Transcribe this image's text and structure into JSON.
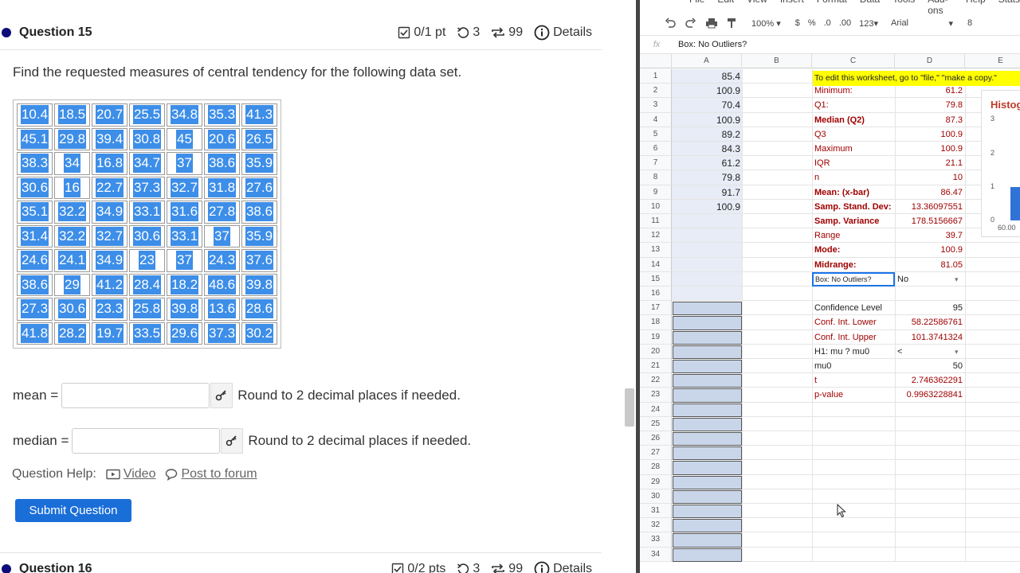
{
  "q15": {
    "title": "Question 15",
    "points": "0/1 pt",
    "retries": "3",
    "attempts": "99",
    "details": "Details",
    "prompt": "Find the requested measures of central tendency for the following data set.",
    "grid": [
      [
        "10.4",
        "18.5",
        "20.7",
        "25.5",
        "34.8",
        "35.3",
        "41.3"
      ],
      [
        "45.1",
        "29.8",
        "39.4",
        "30.8",
        "45",
        "20.6",
        "26.5"
      ],
      [
        "38.3",
        "34",
        "16.8",
        "34.7",
        "37",
        "38.6",
        "35.9"
      ],
      [
        "30.6",
        "16",
        "22.7",
        "37.3",
        "32.7",
        "31.8",
        "27.6"
      ],
      [
        "35.1",
        "32.2",
        "34.9",
        "33.1",
        "31.6",
        "27.8",
        "38.6"
      ],
      [
        "31.4",
        "32.2",
        "32.7",
        "30.6",
        "33.1",
        "37",
        "35.9"
      ],
      [
        "24.6",
        "24.1",
        "34.9",
        "23",
        "37",
        "24.3",
        "37.6"
      ],
      [
        "38.6",
        "29",
        "41.2",
        "28.4",
        "18.2",
        "48.6",
        "39.8"
      ],
      [
        "27.3",
        "30.6",
        "23.3",
        "25.8",
        "39.8",
        "13.6",
        "28.6"
      ],
      [
        "41.8",
        "28.2",
        "19.7",
        "33.5",
        "29.6",
        "37.3",
        "30.2"
      ]
    ],
    "mean_label": "mean =",
    "median_label": "median =",
    "round_hint": "Round to 2 decimal places if needed.",
    "help_label": "Question Help:",
    "video_label": "Video",
    "forum_label": "Post to forum",
    "submit_label": "Submit Question"
  },
  "q16": {
    "title": "Question 16",
    "points": "0/2 pts",
    "retries": "3",
    "attempts": "99",
    "details": "Details"
  },
  "sheet": {
    "menu": [
      "File",
      "Edit",
      "View",
      "Insert",
      "Format",
      "Data",
      "Tools",
      "Add-ons",
      "Help",
      "Stats"
    ],
    "zoom": "100%",
    "currency": "$",
    "percent": "%",
    "dec_less": ".0",
    "dec_more": ".00",
    "numfmt": "123",
    "font": "Arial",
    "font_size": "8",
    "fx_label": "fx",
    "formula": "Box: No Outliers?",
    "columns": [
      "A",
      "B",
      "C",
      "D",
      "E"
    ],
    "colA": [
      "85.4",
      "100.9",
      "70.4",
      "100.9",
      "89.2",
      "84.3",
      "61.2",
      "79.8",
      "91.7",
      "100.9"
    ],
    "banner": "To edit this worksheet, go to \"file,\" \"make a copy.\"",
    "stats": [
      {
        "label": "Minimum:",
        "value": "61.2",
        "bold": false
      },
      {
        "label": "Q1:",
        "value": "79.8",
        "bold": false
      },
      {
        "label": "Median (Q2)",
        "value": "87.3",
        "bold": true
      },
      {
        "label": "Q3",
        "value": "100.9",
        "bold": false
      },
      {
        "label": "Maximum",
        "value": "100.9",
        "bold": false
      },
      {
        "label": "IQR",
        "value": "21.1",
        "bold": false
      },
      {
        "label": "n",
        "value": "10",
        "bold": false
      },
      {
        "label": "Mean: (x-bar)",
        "value": "86.47",
        "bold": true
      },
      {
        "label": "Samp. Stand. Dev:",
        "value": "13.36097551",
        "bold": true
      },
      {
        "label": "Samp. Variance",
        "value": "178.5156667",
        "bold": true
      },
      {
        "label": "Range",
        "value": "39.7",
        "bold": false
      },
      {
        "label": "Mode:",
        "value": "100.9",
        "bold": true
      },
      {
        "label": "Midrange:",
        "value": "81.05",
        "bold": true
      }
    ],
    "box_label": "Box:  No Outliers?",
    "box_value": "No",
    "conf_label": "Confidence Level",
    "conf_value": "95",
    "ci_lower_label": "Conf. Int. Lower",
    "ci_lower_value": "58.22586761",
    "ci_upper_label": "Conf. Int. Upper",
    "ci_upper_value": "101.3741324",
    "h1_label": "H1:  mu ? mu0",
    "h1_value": "<",
    "mu0_label": "mu0",
    "mu0_value": "50",
    "t_label": "t",
    "t_value": "2.746362291",
    "p_label": "p-value",
    "p_value": "0.9963228841",
    "chart_title": "Histog",
    "chart_yticks": [
      "3",
      "2",
      "1",
      "0"
    ],
    "chart_xtick": "60.00"
  }
}
